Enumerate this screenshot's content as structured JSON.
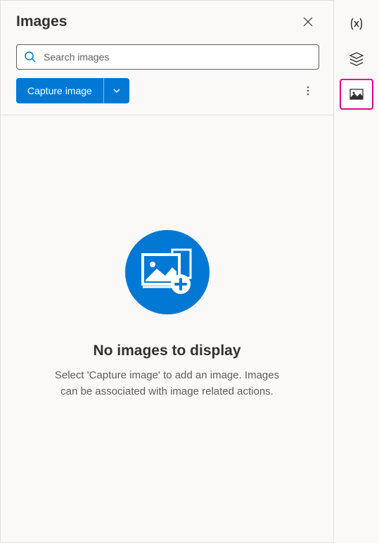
{
  "panel": {
    "title": "Images"
  },
  "search": {
    "placeholder": "Search images"
  },
  "toolbar": {
    "capture_label": "Capture image"
  },
  "empty_state": {
    "title": "No images to display",
    "description": "Select 'Capture image' to add an image. Images can be associated with image related actions."
  },
  "rail": {
    "items": [
      {
        "name": "variables-icon"
      },
      {
        "name": "layers-icon"
      },
      {
        "name": "image-icon",
        "active": true
      }
    ]
  }
}
